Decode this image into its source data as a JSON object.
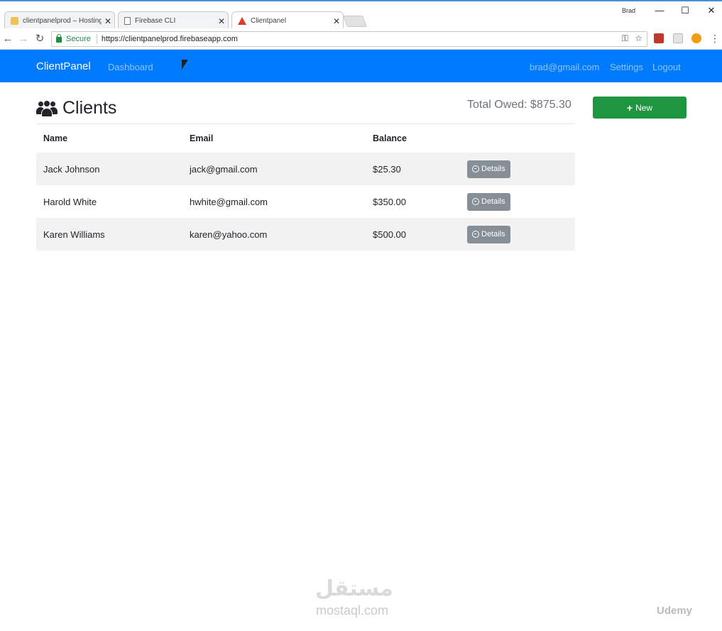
{
  "browser": {
    "tabs": [
      {
        "title": "clientpanelprod – Hosting",
        "icon": "folder-icon",
        "close": "✕"
      },
      {
        "title": "Firebase CLI",
        "icon": "document-icon",
        "close": "✕"
      },
      {
        "title": "Clientpanel",
        "icon": "angular-icon",
        "close": "✕"
      }
    ],
    "window_user": "Brad",
    "window_controls": {
      "minimize": "—",
      "maximize": "☐",
      "close": "✕"
    },
    "nav": {
      "back": "←",
      "forward": "→",
      "reload": "↻"
    },
    "secure_label": "Secure",
    "url": "https://clientpanelprod.firebaseapp.com",
    "omnibox_icons": {
      "key": "⚿",
      "star": "☆"
    },
    "menu": "⋮"
  },
  "navbar": {
    "brand": "ClientPanel",
    "dashboard": "Dashboard",
    "email": "brad@gmail.com",
    "settings": "Settings",
    "logout": "Logout",
    "color": "#007bff"
  },
  "page": {
    "title": "Clients",
    "total_owed": "Total Owed: $875.30",
    "new_button": {
      "icon": "+",
      "label": "New",
      "color": "#1e9640"
    }
  },
  "table": {
    "headers": [
      "Name",
      "Email",
      "Balance",
      ""
    ],
    "rows": [
      {
        "name": "Jack Johnson",
        "email": "jack@gmail.com",
        "balance": "$25.30",
        "action": "Details"
      },
      {
        "name": "Harold White",
        "email": "hwhite@gmail.com",
        "balance": "$350.00",
        "action": "Details"
      },
      {
        "name": "Karen Williams",
        "email": "karen@yahoo.com",
        "balance": "$500.00",
        "action": "Details"
      }
    ]
  },
  "watermarks": {
    "logo": "مستقل",
    "site": "mostaql.com",
    "udemy": "Udemy"
  }
}
